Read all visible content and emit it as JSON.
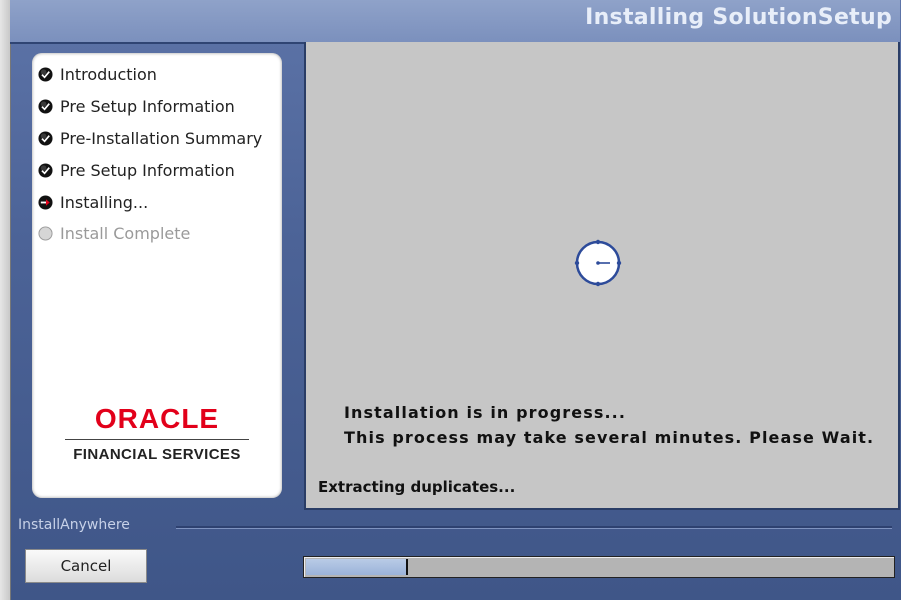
{
  "window": {
    "title": "Installing SolutionSetup"
  },
  "steps": [
    {
      "label": "Introduction",
      "state": "done",
      "icon": "check-circle-icon"
    },
    {
      "label": "Pre Setup Information",
      "state": "done",
      "icon": "check-circle-icon"
    },
    {
      "label": "Pre-Installation Summary",
      "state": "done",
      "icon": "check-circle-icon"
    },
    {
      "label": "Pre Setup Information",
      "state": "done",
      "icon": "check-circle-icon"
    },
    {
      "label": "Installing...",
      "state": "current",
      "icon": "arrow-circle-icon"
    },
    {
      "label": "Install Complete",
      "state": "pending",
      "icon": "empty-circle-icon"
    }
  ],
  "logo": {
    "brand": "ORACLE",
    "subtitle": "FINANCIAL SERVICES",
    "color": "#e2001a"
  },
  "main": {
    "message_line1": "Installation is in progress...",
    "message_line2": "This process may take several minutes. Please Wait.",
    "status": "Extracting duplicates...",
    "spinner_icon": "clock-spinner-icon"
  },
  "footer": {
    "vendor_label": "InstallAnywhere",
    "cancel_label": "Cancel",
    "progress_percent": 17
  },
  "colors": {
    "accent": "#4c6397",
    "panel": "#c6c6c6"
  }
}
